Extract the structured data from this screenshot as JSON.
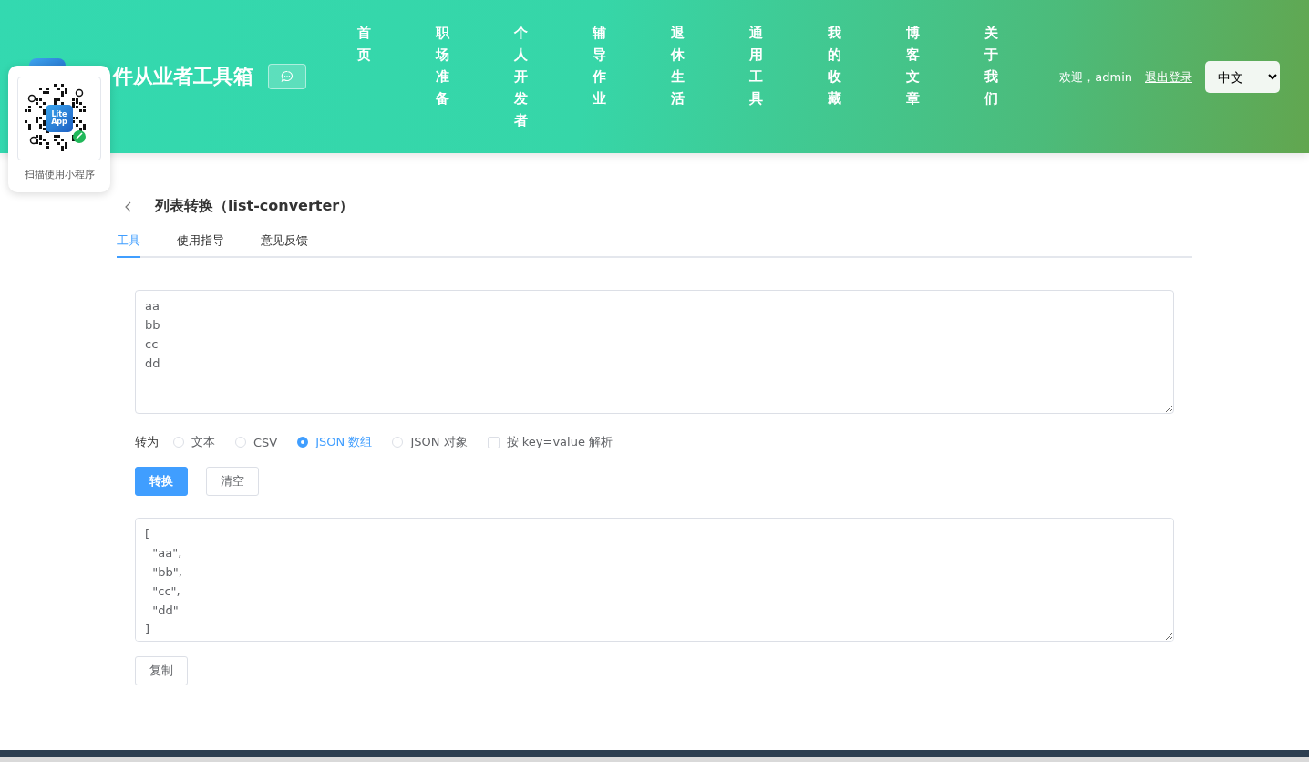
{
  "header": {
    "title": "件从业者工具箱",
    "nav": [
      {
        "label": "首页"
      },
      {
        "label": "职场准备"
      },
      {
        "label": "个人开发者"
      },
      {
        "label": "辅导作业"
      },
      {
        "label": "退休生活"
      },
      {
        "label": "通用工具"
      },
      {
        "label": "我的收藏"
      },
      {
        "label": "博客文章"
      },
      {
        "label": "关于我们"
      }
    ],
    "welcome": "欢迎，admin",
    "logout": "退出登录",
    "language": "中文"
  },
  "mini_program_popup": {
    "badge": "Lite\nApp",
    "caption": "扫描使用小程序"
  },
  "page": {
    "title": "列表转换（list-converter）",
    "tabs": [
      {
        "label": "工具",
        "selected": true
      },
      {
        "label": "使用指导",
        "selected": false
      },
      {
        "label": "意见反馈",
        "selected": false
      }
    ]
  },
  "input": {
    "value": "aa\nbb\ncc\ndd"
  },
  "convert_to": {
    "label": "转为",
    "options": [
      {
        "kind": "radio",
        "label": "文本",
        "selected": false
      },
      {
        "kind": "radio",
        "label": "CSV",
        "selected": false
      },
      {
        "kind": "radio",
        "label": "JSON 数组",
        "selected": true
      },
      {
        "kind": "radio",
        "label": "JSON 对象",
        "selected": false
      },
      {
        "kind": "checkbox",
        "label": "按 key=value 解析",
        "checked": false
      }
    ]
  },
  "buttons": [
    {
      "label": "转换",
      "primary": true
    },
    {
      "label": "清空",
      "primary": false
    }
  ],
  "output": {
    "value": "[\n  \"aa\",\n  \"bb\",\n  \"cc\",\n  \"dd\"\n]"
  },
  "copy_button": "复制"
}
